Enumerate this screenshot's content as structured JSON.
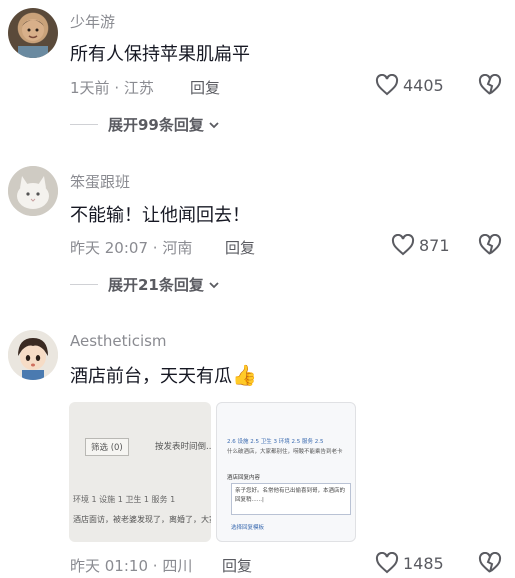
{
  "comments": [
    {
      "username": "少年游",
      "text": "所有人保持苹果肌扁平",
      "time": "1天前",
      "location": "江苏",
      "reply_label": "回复",
      "likes": "4405",
      "expand_label": "展开99条回复"
    },
    {
      "username": "笨蛋跟班",
      "text": "不能输！让他闻回去！",
      "time": "昨天 20:07",
      "location": "河南",
      "reply_label": "回复",
      "likes": "871",
      "expand_label": "展开21条回复"
    },
    {
      "username": "Aestheticism",
      "text": "酒店前台，天天有瓜",
      "emoji": "👍",
      "time": "昨天 01:10",
      "location": "四川",
      "reply_label": "回复",
      "likes": "1485",
      "images": [
        {
          "filter_label": "筛选 (0)",
          "sort_label": "按发表时间倒...",
          "row1": "环境 1   设施 1   卫生 1   服务 1",
          "row2": "酒店面访，被老婆发现了，离婚了，大家..."
        },
        {
          "rating_line": "2.6  设施 2.5  卫生 3  环境 2.5  服务 2.5",
          "line2": "什么破酒店，大家都别住，唠酸不能乘告到老卡",
          "box_title": "酒店回复内容",
          "box_text": "亲子您好。名常他有已出偷喜到哥，本酒店的回复稍......|",
          "footer": "选择回复模板"
        }
      ]
    }
  ],
  "colors": {
    "accent_red": "#fe2c55",
    "text_gray": "#8a8b91"
  }
}
